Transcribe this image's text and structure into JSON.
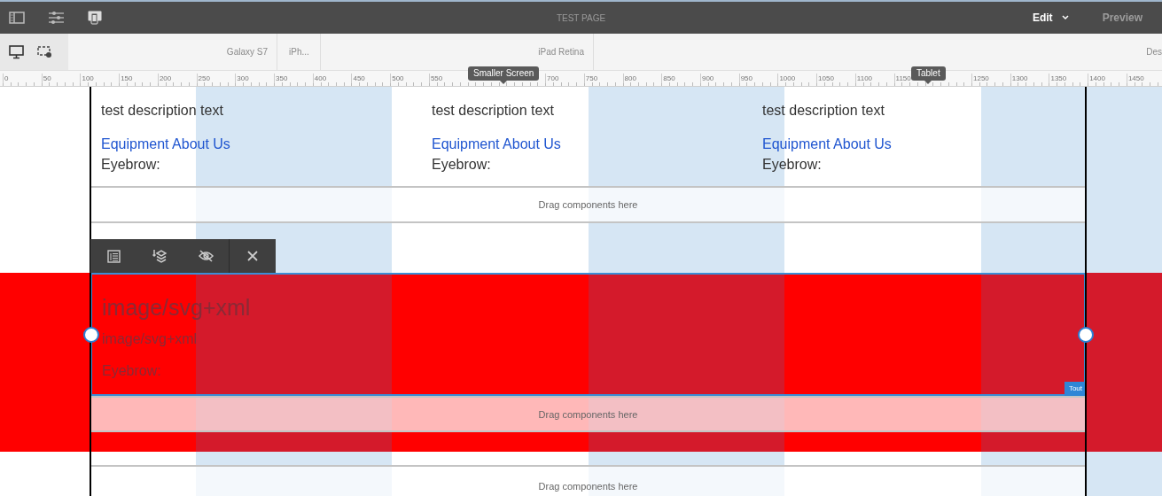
{
  "topbar": {
    "title": "TEST PAGE",
    "mode": "Edit",
    "preview": "Preview"
  },
  "devices": {
    "breakpoints": [
      {
        "label": "Galaxy S7"
      },
      {
        "label": "iPh..."
      },
      {
        "label": "iPad Retina"
      },
      {
        "label": "Des"
      }
    ]
  },
  "ruler": {
    "labels": [
      "0",
      "50",
      "100",
      "150",
      "200",
      "250",
      "300",
      "350",
      "400",
      "450",
      "500",
      "550",
      "700",
      "750",
      "800",
      "850",
      "900",
      "950",
      "1000",
      "1050",
      "1100",
      "1150",
      "1250",
      "1300",
      "1350",
      "1400",
      "1450"
    ],
    "markers": [
      {
        "label": "Smaller Screen"
      },
      {
        "label": "Tablet"
      }
    ]
  },
  "columns": [
    {
      "description": "test description text",
      "link": "Equipment About Us",
      "eyebrow": "Eyebrow:"
    },
    {
      "description": "test description text",
      "link": "Equipment About Us",
      "eyebrow": "Eyebrow:"
    },
    {
      "description": "test description text",
      "link": "Equipment About Us",
      "eyebrow": "Eyebrow:"
    }
  ],
  "top_dropzone": "Drag components here",
  "selected_component": {
    "title": "image/svg+xml",
    "subtitle": "image/svg+xml",
    "eyebrow": "Eyebrow:",
    "tag": "Tout",
    "dropzone": "Drag components here"
  },
  "bottom_dropzone": "Drag components here"
}
